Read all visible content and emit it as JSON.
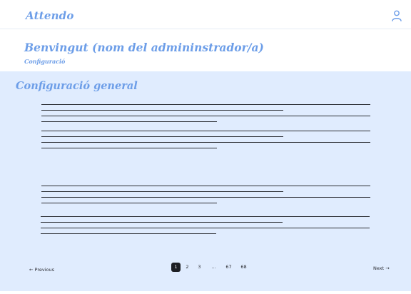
{
  "header": {
    "brand": "Attendo",
    "user_icon": "user-icon"
  },
  "welcome": "Benvingut (nom del admininstrador/a)",
  "breadcrumb": "Configuració",
  "panel": {
    "title": "Configuració general",
    "background": "#e0ecfe"
  },
  "pagination": {
    "previous": "← Previous",
    "next": "Next →",
    "pages": [
      "1",
      "2",
      "3",
      "...",
      "67",
      "68"
    ],
    "current_page": "1"
  },
  "colors": {
    "accent": "#6d9ee8",
    "text_dark": "#2b2d33"
  }
}
